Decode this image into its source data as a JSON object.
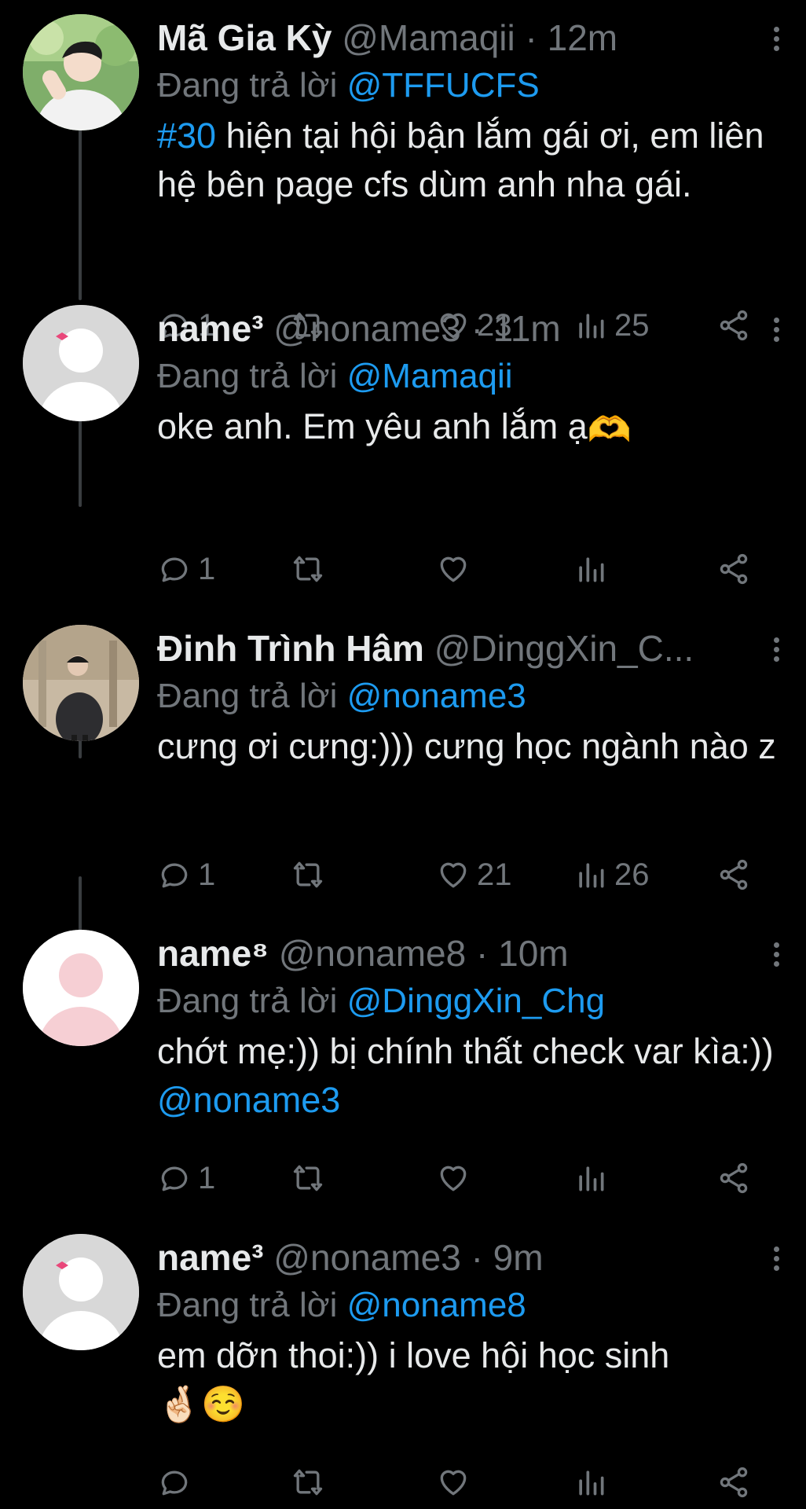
{
  "reply_prefix": "Đang trả lời",
  "tweets": [
    {
      "name": "Mã Gia Kỳ",
      "handle": "@Mamaqii",
      "separator": "·",
      "time": "12m",
      "reply_to": "@TFFUCFS",
      "hashtag": "#30",
      "text": " hiện tại hội bận lắm gái ơi, em liên hệ bên page cfs dùm anh nha gái.",
      "replies": "1",
      "retweets": "",
      "likes": "23",
      "views": "25",
      "avatar": "photo-person-white-shirt"
    },
    {
      "name": "name³",
      "handle": "@noname3",
      "separator": "·",
      "time": "11m",
      "reply_to": "@Mamaqii",
      "text": "oke anh. Em yêu anh lắm ạ",
      "emoji": "🫶",
      "replies": "1",
      "retweets": "",
      "likes": "",
      "views": "",
      "avatar": "default-avatar-bow"
    },
    {
      "name": "Đinh Trình Hâm",
      "handle": "@DinggXin_C...",
      "separator": "",
      "time": "",
      "reply_to": "@noname3",
      "text": "cưng ơi cưng:))) cưng học ngành nào z",
      "replies": "1",
      "retweets": "",
      "likes": "21",
      "views": "26",
      "avatar": "photo-person-black-hoodie"
    },
    {
      "name": "name⁸",
      "handle": "@noname8",
      "separator": "·",
      "time": "10m",
      "reply_to": "@DinggXin_Chg",
      "text": "chớt mẹ:)) bị chính thất check var kìa:)) ",
      "mention_in_text": "@noname3",
      "replies": "1",
      "retweets": "",
      "likes": "",
      "views": "",
      "avatar": "default-avatar-pink"
    },
    {
      "name": "name³",
      "handle": "@noname3",
      "separator": "·",
      "time": "9m",
      "reply_to": "@noname8",
      "text": "em dỡn thoi:)) i love hội học sinh",
      "emoji": "🤞🏻☺️",
      "replies": "",
      "retweets": "",
      "likes": "",
      "views": "",
      "avatar": "default-avatar-bow"
    }
  ],
  "colors": {
    "background": "#000000",
    "text": "#e7e9ea",
    "secondary": "#71767b",
    "link": "#1d9bf0",
    "thread_line": "#3a3d40"
  }
}
